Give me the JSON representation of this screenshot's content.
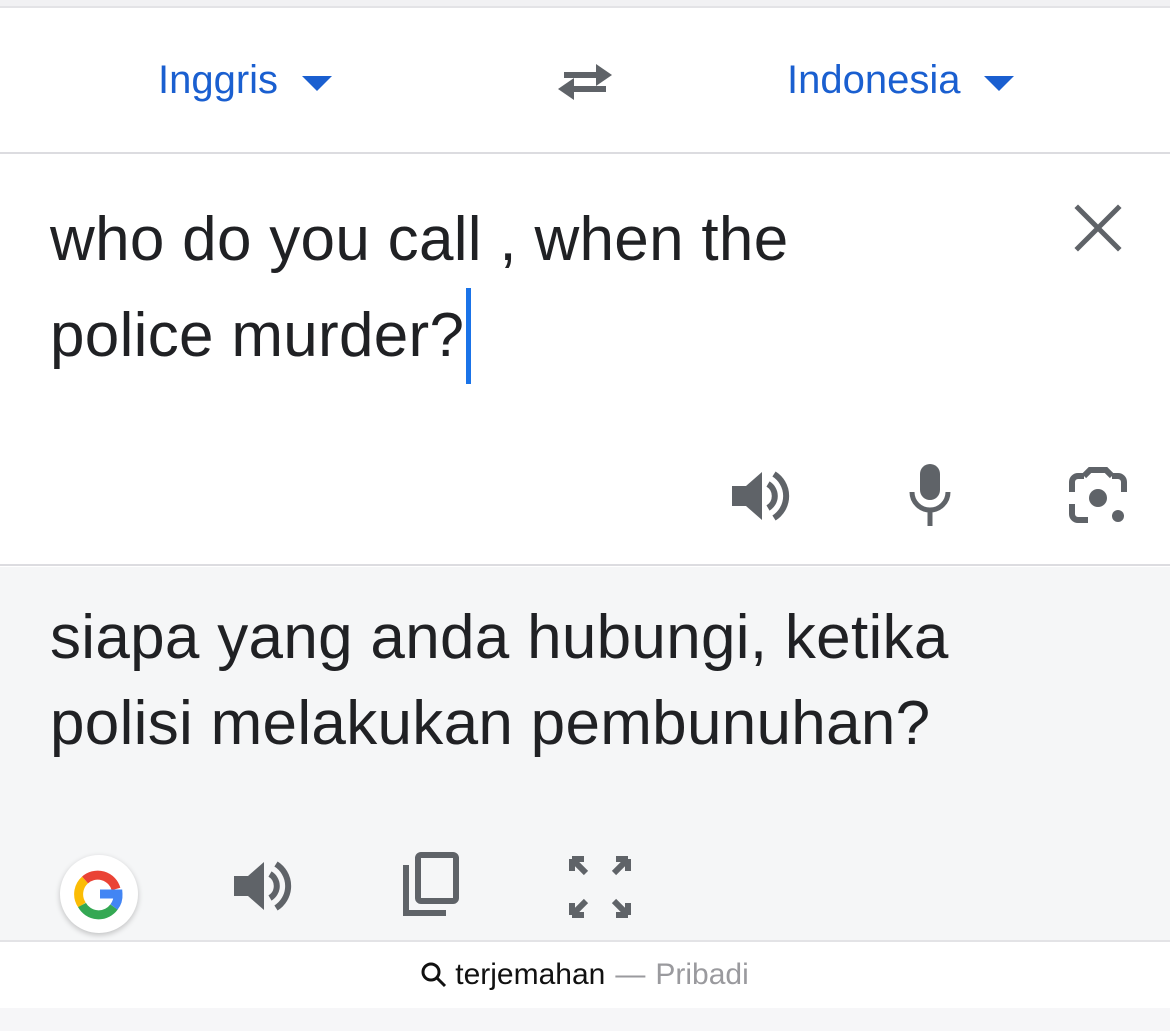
{
  "language_bar": {
    "source_language": "Inggris",
    "target_language": "Indonesia",
    "swap_icon": "swap-arrows-icon"
  },
  "input": {
    "lines": [
      "who do you call , when the",
      "police murder?"
    ],
    "clear_icon": "close-icon",
    "actions": [
      "speaker-icon",
      "microphone-icon",
      "camera-icon"
    ]
  },
  "output": {
    "lines": [
      "siapa yang anda hubungi, ketika",
      "polisi melakukan pembunuhan?"
    ],
    "actions": [
      "google-logo-icon",
      "speaker-icon",
      "copy-icon",
      "fullscreen-icon"
    ]
  },
  "address_bar": {
    "query": "terjemahan",
    "separator": "—",
    "mode": "Pribadi"
  },
  "colors": {
    "accent": "#1a5fd0",
    "caret": "#1a73e8",
    "icon": "#5f6368",
    "output_bg": "#f5f6f7"
  }
}
